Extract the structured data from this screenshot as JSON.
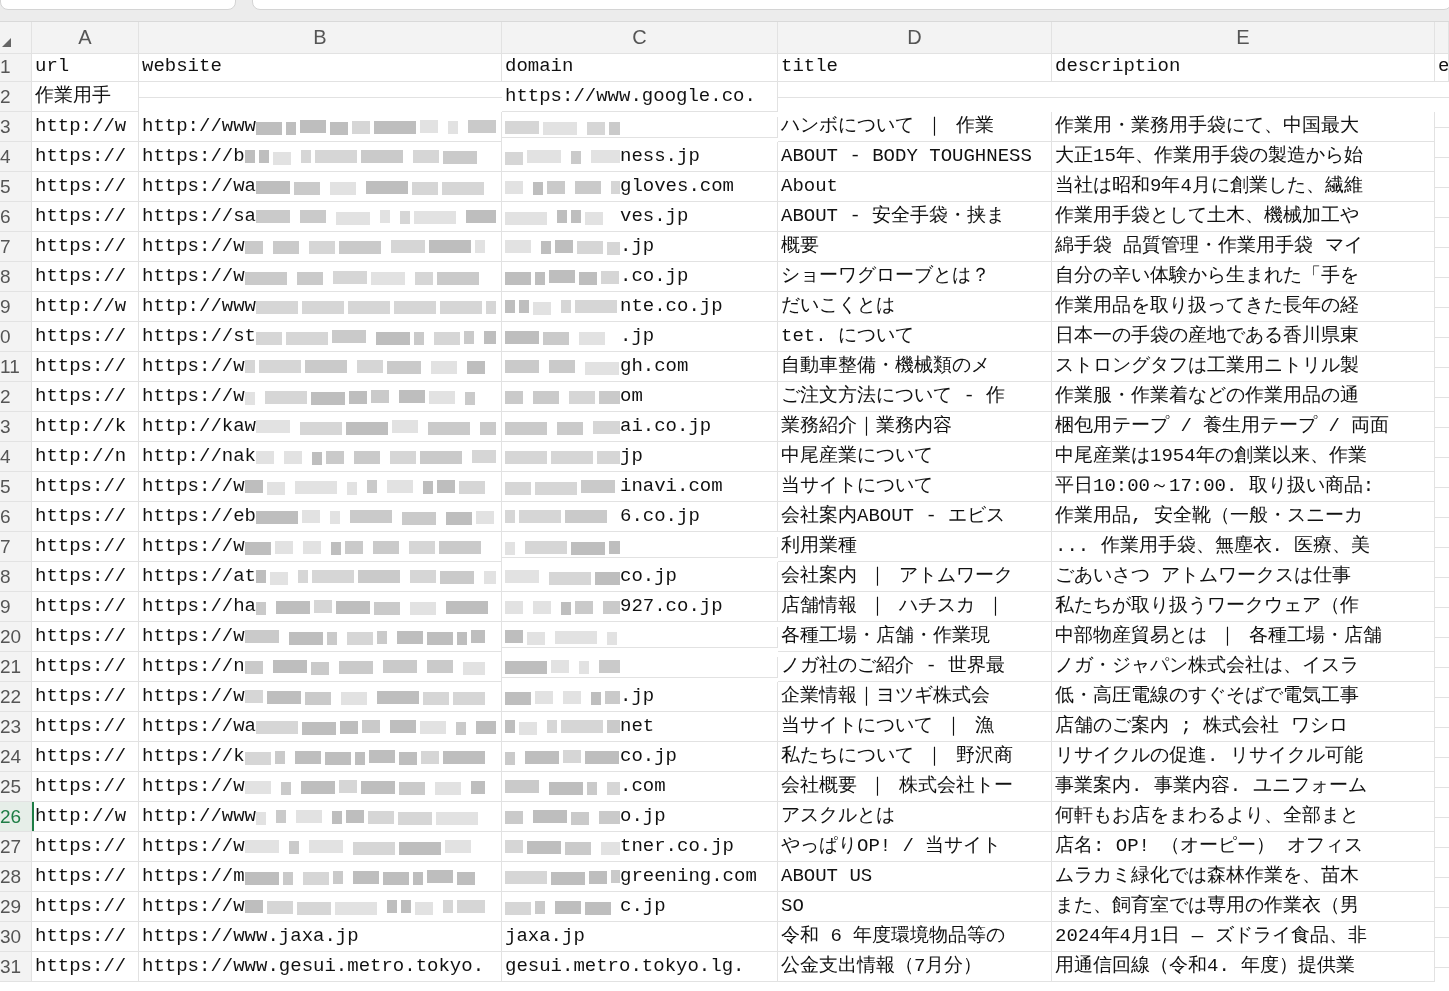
{
  "columns": [
    "A",
    "B",
    "C",
    "D",
    "E"
  ],
  "rows": [
    {
      "number": "1",
      "selected": false,
      "redacted": false,
      "url": "url",
      "website": "website",
      "domain": "domain",
      "title": "title",
      "description": "description",
      "column_6": "e"
    },
    {
      "number": "2",
      "selected": false,
      "redacted": false,
      "url": "作業用手",
      "domain": "https://www.google.co."
    },
    {
      "number": "3",
      "selected": false,
      "redacted": true,
      "url": "http://w",
      "website": "http://www",
      "title": "ハンボについて ｜ 作業",
      "description": "作業用・業務用手袋にて、中国最大"
    },
    {
      "number": "4",
      "selected": false,
      "redacted": true,
      "url": "https://",
      "website": "https://b",
      "domain": "ness.jp",
      "title": "ABOUT - BODY TOUGHNESS",
      "description": "大正15年、作業用手袋の製造から始"
    },
    {
      "number": "5",
      "selected": false,
      "redacted": true,
      "url": "https://",
      "website": "https://wa",
      "domain": "gloves.com",
      "title": "About",
      "description": "当社は昭和9年4月に創業した、繊維"
    },
    {
      "number": "6",
      "selected": false,
      "redacted": true,
      "url": "https://",
      "website": "https://sa",
      "domain": "ves.jp",
      "title": "ABOUT - 安全手袋・挟ま",
      "description": "作業用手袋として土木、機械加工や"
    },
    {
      "number": "7",
      "selected": false,
      "redacted": true,
      "url": "https://",
      "website": "https://w",
      "domain": ".jp",
      "title": "概要",
      "description": "綿手袋 品質管理・作業用手袋 マイ"
    },
    {
      "number": "8",
      "selected": false,
      "redacted": true,
      "url": "https://",
      "website": "https://w",
      "domain": ".co.jp",
      "title": "ショーワグローブとは？",
      "description": "自分の辛い体験から生まれた「手を"
    },
    {
      "number": "9",
      "selected": false,
      "redacted": true,
      "url": "http://w",
      "website": "http://www",
      "domain": "nte.co.jp",
      "title": "だいこくとは",
      "description": "作業用品を取り扱ってきた長年の経"
    },
    {
      "number": "0",
      "selected": false,
      "redacted": true,
      "url": "https://",
      "website": "https://st",
      "domain": ".jp",
      "title": "tet. について",
      "description": "日本一の手袋の産地である香川県東"
    },
    {
      "number": "11",
      "selected": false,
      "redacted": true,
      "url": "https://",
      "website": "https://w",
      "domain": "gh.com",
      "title": "自動車整備・機械類のメ",
      "description": "ストロングタフは工業用ニトリル製"
    },
    {
      "number": "2",
      "selected": false,
      "redacted": true,
      "url": "https://",
      "website": "https://w",
      "domain": "om",
      "title": "ご注文方法について - 作",
      "description": "作業服・作業着などの作業用品の通"
    },
    {
      "number": "3",
      "selected": false,
      "redacted": true,
      "url": "http://k",
      "website": "http://kaw",
      "domain": "ai.co.jp",
      "title": "業務紹介｜業務内容",
      "description": "梱包用テープ / 養生用テープ / 両面"
    },
    {
      "number": "4",
      "selected": false,
      "redacted": true,
      "url": "http://n",
      "website": "http://nak",
      "domain": "jp",
      "title": "中尾産業について",
      "description": "中尾産業は1954年の創業以来、作業"
    },
    {
      "number": "5",
      "selected": false,
      "redacted": true,
      "url": "https://",
      "website": "https://w",
      "domain": "inavi.com",
      "title": "当サイトについて",
      "description": "平日10:00～17:00. 取り扱い商品:"
    },
    {
      "number": "6",
      "selected": false,
      "redacted": true,
      "url": "https://",
      "website": "https://eb",
      "domain": "6.co.jp",
      "title": "会社案内ABOUT - エビス",
      "description": "作業用品, 安全靴（一般・スニーカ"
    },
    {
      "number": "7",
      "selected": false,
      "redacted": true,
      "url": "https://",
      "website": "https://w",
      "title": "利用業種",
      "description": "... 作業用手袋、無塵衣. 医療、美"
    },
    {
      "number": "8",
      "selected": false,
      "redacted": true,
      "url": "https://",
      "website": "https://at",
      "domain": "co.jp",
      "title": "会社案内 ｜ アトムワーク",
      "description": "ごあいさつ アトムワークスは仕事"
    },
    {
      "number": "9",
      "selected": false,
      "redacted": true,
      "url": "https://",
      "website": "https://ha",
      "domain": "927.co.jp",
      "title": "店舗情報 ｜ ハチスカ ｜",
      "description": "私たちが取り扱うワークウェア（作"
    },
    {
      "number": "20",
      "selected": false,
      "redacted": true,
      "url": "https://",
      "website": "https://w",
      "title": "各種工場・店舗・作業現",
      "description": "中部物産貿易とは ｜ 各種工場・店舗"
    },
    {
      "number": "21",
      "selected": false,
      "redacted": true,
      "url": "https://",
      "website": "https://n",
      "title": "ノガ社のご紹介 - 世界最",
      "description": "ノガ・ジャパン株式会社は、イスラ"
    },
    {
      "number": "22",
      "selected": false,
      "redacted": true,
      "url": "https://",
      "website": "https://w",
      "domain": ".jp",
      "title": "企業情報｜ヨツギ株式会",
      "description": "低・高圧電線のすぐそばで電気工事"
    },
    {
      "number": "23",
      "selected": false,
      "redacted": true,
      "url": "https://",
      "website": "https://wa",
      "domain": "net",
      "title": "当サイトについて ｜ 漁",
      "description": "店舗のご案内 ; 株式会社 ワシロ"
    },
    {
      "number": "24",
      "selected": false,
      "redacted": true,
      "url": "https://",
      "website": "https://k",
      "domain": "co.jp",
      "title": "私たちについて ｜ 野沢商",
      "description": "リサイクルの促進. リサイクル可能"
    },
    {
      "number": "25",
      "selected": false,
      "redacted": true,
      "url": "https://",
      "website": "https://w",
      "domain": ".com",
      "title": "会社概要 ｜ 株式会社トー",
      "description": "事業案内. 事業内容. ユニフォーム"
    },
    {
      "number": "26",
      "selected": true,
      "redacted": true,
      "url": "http://w",
      "website": "http://www",
      "domain": "o.jp",
      "title": "アスクルとは",
      "description": "何軒もお店をまわるより、全部まと"
    },
    {
      "number": "27",
      "selected": false,
      "redacted": true,
      "url": "https://",
      "website": "https://w",
      "domain": "tner.co.jp",
      "title": "やっぱりOP! / 当サイト",
      "description": "店名: OP! （オーピー） オフィス"
    },
    {
      "number": "28",
      "selected": false,
      "redacted": true,
      "url": "https://",
      "website": "https://m",
      "domain": "greening.com",
      "title": "ABOUT US",
      "description": "ムラカミ緑化では森林作業を、苗木"
    },
    {
      "number": "29",
      "selected": false,
      "redacted": true,
      "url": "https://",
      "website": "https://w",
      "domain": "c.jp",
      "title": "SO",
      "description": "また、飼育室では専用の作業衣（男"
    },
    {
      "number": "30",
      "selected": false,
      "redacted": false,
      "url": "https://",
      "website": "https://www.jaxa.jp",
      "domain": "jaxa.jp",
      "title": "令和 6 年度環境物品等の",
      "description": "2024年4月1日 — ズドライ食品、非"
    },
    {
      "number": "31",
      "selected": false,
      "redacted": false,
      "url": "https://",
      "website": "https://www.gesui.metro.tokyo.",
      "domain": "gesui.metro.tokyo.lg.",
      "title": "公金支出情報（7月分）",
      "description": "用通信回線（令和4. 年度）提供業"
    }
  ]
}
